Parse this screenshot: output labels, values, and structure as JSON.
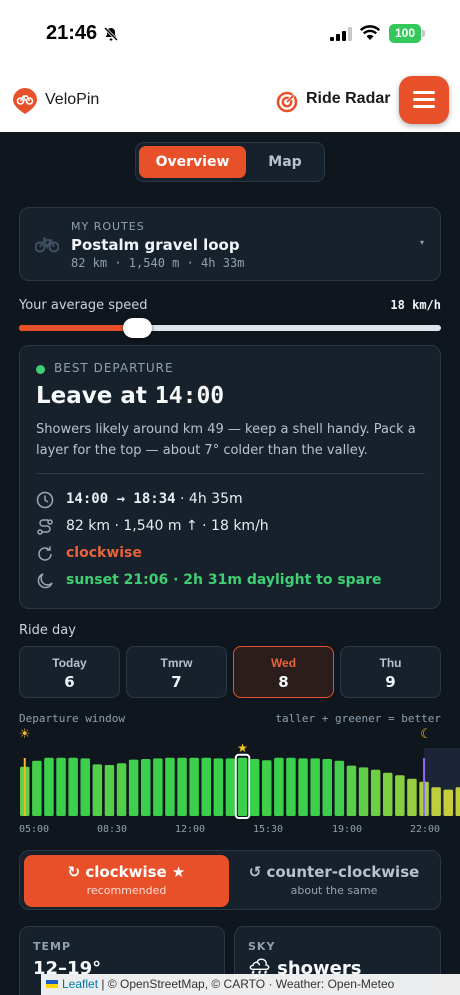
{
  "status_bar": {
    "time": "21:46",
    "battery": "100"
  },
  "header": {
    "brand": "VeloPin",
    "radar_label": "Ride Radar"
  },
  "tabs": [
    {
      "label": "Overview",
      "active": true
    },
    {
      "label": "Map",
      "active": false
    }
  ],
  "routes": {
    "kicker": "MY ROUTES",
    "name": "Postalm gravel loop",
    "meta": "82 km · 1,540 m · 4h 33m",
    "caret": "▾"
  },
  "speed": {
    "label": "Your average speed",
    "value": "18 km/h",
    "fraction": 0.28
  },
  "best": {
    "kicker": "BEST DEPARTURE",
    "title_prefix": "Leave at ",
    "title_time": "14:00",
    "description": "Showers likely around km 49 — keep a shell handy. Pack a layer for the top — about 7° colder than the valley.",
    "time_range": "14:00 → 18:34",
    "duration": " · 4h 35m",
    "distance": "82 km · 1,540 m ↑ · 18 km/h",
    "direction": "clockwise",
    "sunset": "sunset 21:06 · 2h 31m daylight to spare",
    "colors": {
      "accent": "#e8502a",
      "green": "#3ecf72"
    }
  },
  "ride_day": {
    "label": "Ride day",
    "days": [
      {
        "name": "Today",
        "num": "6",
        "selected": false
      },
      {
        "name": "Tmrw",
        "num": "7",
        "selected": false
      },
      {
        "name": "Wed",
        "num": "8",
        "selected": true
      },
      {
        "name": "Thu",
        "num": "9",
        "selected": false
      }
    ]
  },
  "chart_data": {
    "type": "bar",
    "title": "Departure window",
    "hint": "taller + greener = better",
    "x_tick_labels": [
      "05:00",
      "08:30",
      "12:00",
      "15:30",
      "19:00",
      "22:00"
    ],
    "first_slot": "05:00",
    "slot_minutes": 30,
    "values": [
      0.82,
      0.92,
      0.97,
      0.97,
      0.97,
      0.96,
      0.86,
      0.85,
      0.88,
      0.94,
      0.95,
      0.96,
      0.97,
      0.97,
      0.97,
      0.97,
      0.96,
      0.96,
      0.97,
      0.95,
      0.93,
      0.97,
      0.97,
      0.96,
      0.96,
      0.95,
      0.92,
      0.84,
      0.81,
      0.77,
      0.72,
      0.68,
      0.62,
      0.57,
      0.48,
      0.44,
      0.48,
      0.47
    ],
    "selected_index": 18,
    "sunrise_index": 0,
    "sunset_index": 33,
    "ylim": [
      0,
      1
    ]
  },
  "direction": {
    "clockwise": {
      "label": "↻ clockwise ★",
      "sub": "recommended"
    },
    "counter": {
      "label": "↺ counter-clockwise",
      "sub": "about the same"
    }
  },
  "stats": {
    "temp": {
      "kicker": "TEMP",
      "value": "12–19°"
    },
    "sky": {
      "kicker": "SKY",
      "value": "🌧 showers"
    }
  },
  "attribution": {
    "leaflet": "Leaflet",
    "rest": " | © OpenStreetMap, © CARTO · Weather: Open-Meteo"
  }
}
